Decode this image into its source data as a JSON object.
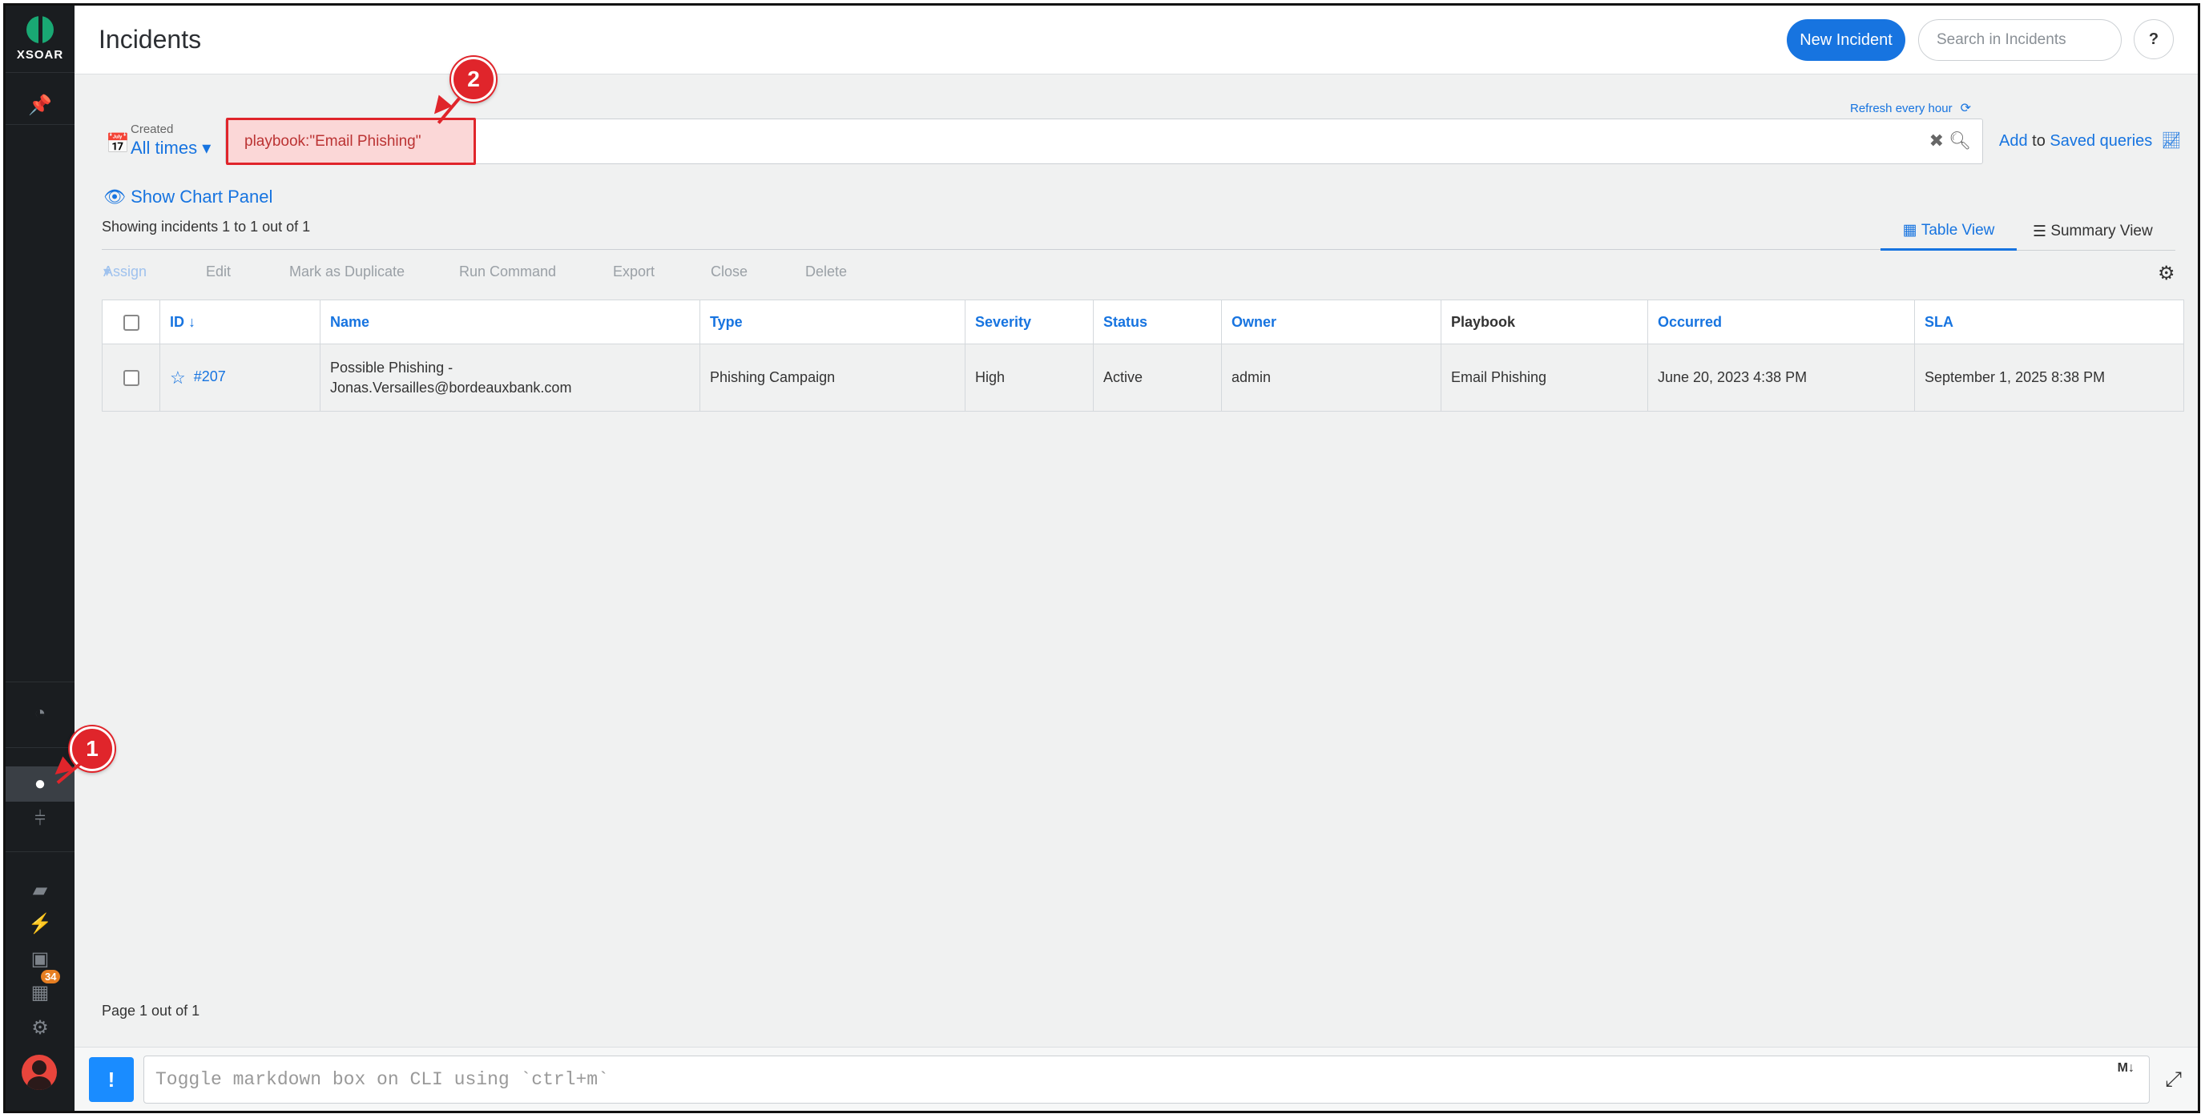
{
  "app": {
    "logo_text": "XSOAR"
  },
  "header": {
    "title": "Incidents",
    "new_incident_label": "New Incident",
    "search_placeholder": "Search in Incidents",
    "help_label": "?"
  },
  "sidebar": {
    "icons": [
      "pin-icon",
      "dashboard-icon",
      "incidents-icon",
      "jobs-icon",
      "playbooks-icon",
      "automation-icon",
      "marketplace-icon",
      "threat-intel-icon",
      "settings-icon",
      "user-avatar"
    ],
    "badge_count": "34"
  },
  "query": {
    "refresh_label": "Refresh every hour",
    "created_label": "Created",
    "created_value": "All times",
    "query_text": "playbook:\"Email Phishing\"",
    "add_label": "Add",
    "to_label": "to",
    "saved_queries_label": "Saved queries"
  },
  "list": {
    "chart_toggle_label": "Show Chart Panel",
    "showing_text": "Showing incidents 1 to 1 out of 1",
    "table_view_label": "Table View",
    "summary_view_label": "Summary View",
    "toolbar": {
      "assign": "Assign",
      "edit": "Edit",
      "mark_duplicate": "Mark as Duplicate",
      "run_command": "Run Command",
      "export": "Export",
      "close": "Close",
      "delete": "Delete"
    }
  },
  "table": {
    "headers": {
      "id": "ID ↓",
      "name": "Name",
      "type": "Type",
      "severity": "Severity",
      "status": "Status",
      "owner": "Owner",
      "playbook": "Playbook",
      "occurred": "Occurred",
      "sla": "SLA"
    },
    "rows": [
      {
        "id": "#207",
        "name_line1": "Possible Phishing -",
        "name_line2": "Jonas.Versailles@bordeauxbank.com",
        "type": "Phishing Campaign",
        "severity": "High",
        "status": "Active",
        "owner": "admin",
        "playbook": "Email Phishing",
        "occurred": "June 20, 2023 4:38 PM",
        "sla": "September 1, 2025 8:38 PM"
      }
    ]
  },
  "pagination": {
    "text": "Page 1 out of 1"
  },
  "cli": {
    "button_label": "!",
    "placeholder": "Toggle markdown box on CLI using `ctrl+m`",
    "md_label": "M↓"
  },
  "annotations": {
    "callout_1": "1",
    "callout_2": "2"
  },
  "colors": {
    "accent": "#1774e0",
    "sidebar": "#1a1d20",
    "callout": "#e0252b",
    "brand": "#19a873"
  }
}
